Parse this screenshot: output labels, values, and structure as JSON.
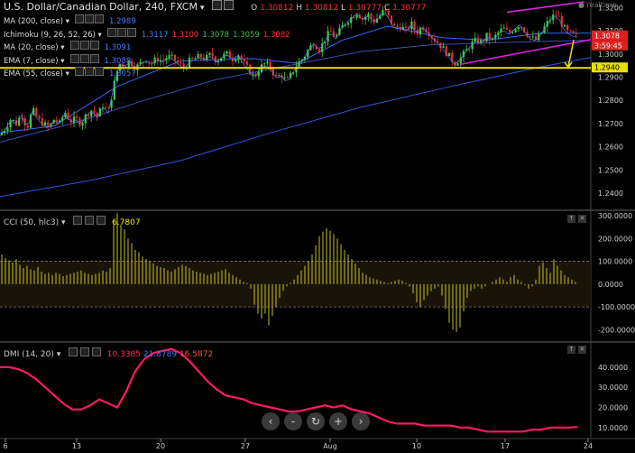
{
  "chart_data": [
    {
      "type": "candlestick",
      "title": "U.S. Dollar/Canadian Dollar, 240, FXCM",
      "ohlc_label": {
        "o": "O",
        "o_val": "1.30812",
        "h": "H",
        "h_val": "1.30812",
        "l": "L",
        "l_val": "1.30777",
        "c": "C",
        "c_val": "1.30777"
      },
      "indicators": [
        {
          "name": "MA (200, close)",
          "values": [
            "1.2989"
          ],
          "color": "#4a78ff"
        },
        {
          "name": "Ichimoku (9, 26, 52, 26)",
          "values": [
            "1.3117",
            "1.3100",
            "1.3078",
            "1.3059",
            "1.3082"
          ],
          "colors": [
            "#3f7fff",
            "#ff3030",
            "#40c040",
            "#40c040",
            "#ff3030"
          ]
        },
        {
          "name": "MA (20, close)",
          "values": [
            "1.3091"
          ],
          "color": "#4a78ff"
        },
        {
          "name": "EMA (7, close)",
          "values": [
            "1.3088"
          ],
          "color": "#4a78ff"
        },
        {
          "name": "EMA (55, close)",
          "values": [
            "1.3057"
          ],
          "color": "#4a78ff"
        }
      ],
      "ylim": [
        1.233,
        1.3225
      ],
      "y_ticks": [
        "1.3200",
        "1.3100",
        "1.3000",
        "1.2900",
        "1.2800",
        "1.2700",
        "1.2600",
        "1.2500",
        "1.2400"
      ],
      "price_badges": [
        {
          "label": "1.3078",
          "color": "#e02020",
          "value": 1.3078
        },
        {
          "label": "3:59:45",
          "color": "#e02020"
        },
        {
          "label": "1.2940",
          "color": "#e8e000",
          "value": 1.294
        }
      ],
      "support_level": 1.294,
      "price_path": [
        [
          0,
          1.265
        ],
        [
          6,
          1.268
        ],
        [
          12,
          1.272
        ],
        [
          18,
          1.27
        ],
        [
          24,
          1.274
        ],
        [
          30,
          1.268
        ],
        [
          36,
          1.276
        ],
        [
          42,
          1.272
        ],
        [
          48,
          1.27
        ],
        [
          54,
          1.268
        ],
        [
          60,
          1.272
        ],
        [
          66,
          1.27
        ],
        [
          72,
          1.275
        ],
        [
          78,
          1.271
        ],
        [
          84,
          1.272
        ],
        [
          90,
          1.27
        ],
        [
          96,
          1.274
        ],
        [
          102,
          1.276
        ],
        [
          108,
          1.273
        ],
        [
          114,
          1.278
        ],
        [
          120,
          1.275
        ],
        [
          126,
          1.286
        ],
        [
          132,
          1.296
        ],
        [
          138,
          1.295
        ],
        [
          144,
          1.297
        ],
        [
          150,
          1.294
        ],
        [
          156,
          1.296
        ],
        [
          162,
          1.298
        ],
        [
          168,
          1.296
        ],
        [
          174,
          1.298
        ],
        [
          180,
          1.297
        ],
        [
          186,
          1.299
        ],
        [
          192,
          1.298
        ],
        [
          198,
          1.296
        ],
        [
          204,
          1.294
        ],
        [
          210,
          1.297
        ],
        [
          216,
          1.298
        ],
        [
          222,
          1.299
        ],
        [
          228,
          1.298
        ],
        [
          234,
          1.3
        ],
        [
          240,
          1.297
        ],
        [
          246,
          1.299
        ],
        [
          252,
          1.3
        ],
        [
          258,
          1.298
        ],
        [
          264,
          1.3
        ],
        [
          270,
          1.296
        ],
        [
          276,
          1.293
        ],
        [
          282,
          1.29
        ],
        [
          288,
          1.294
        ],
        [
          294,
          1.296
        ],
        [
          300,
          1.294
        ],
        [
          306,
          1.29
        ],
        [
          312,
          1.291
        ],
        [
          318,
          1.288
        ],
        [
          324,
          1.292
        ],
        [
          330,
          1.296
        ],
        [
          336,
          1.298
        ],
        [
          342,
          1.302
        ],
        [
          348,
          1.305
        ],
        [
          354,
          1.302
        ],
        [
          360,
          1.306
        ],
        [
          366,
          1.31
        ],
        [
          372,
          1.307
        ],
        [
          378,
          1.311
        ],
        [
          384,
          1.314
        ],
        [
          390,
          1.316
        ],
        [
          396,
          1.318
        ],
        [
          402,
          1.315
        ],
        [
          408,
          1.317
        ],
        [
          414,
          1.314
        ],
        [
          420,
          1.316
        ],
        [
          426,
          1.319
        ],
        [
          432,
          1.315
        ],
        [
          438,
          1.311
        ],
        [
          444,
          1.312
        ],
        [
          450,
          1.31
        ],
        [
          456,
          1.313
        ],
        [
          462,
          1.309
        ],
        [
          468,
          1.312
        ],
        [
          474,
          1.31
        ],
        [
          480,
          1.307
        ],
        [
          486,
          1.305
        ],
        [
          492,
          1.302
        ],
        [
          498,
          1.299
        ],
        [
          504,
          1.296
        ],
        [
          510,
          1.298
        ],
        [
          516,
          1.301
        ],
        [
          522,
          1.304
        ],
        [
          528,
          1.306
        ],
        [
          534,
          1.305
        ],
        [
          540,
          1.308
        ],
        [
          546,
          1.306
        ],
        [
          552,
          1.309
        ],
        [
          558,
          1.311
        ],
        [
          564,
          1.309
        ],
        [
          570,
          1.311
        ],
        [
          576,
          1.313
        ],
        [
          582,
          1.31
        ],
        [
          588,
          1.307
        ],
        [
          594,
          1.306
        ],
        [
          600,
          1.309
        ],
        [
          606,
          1.313
        ],
        [
          612,
          1.316
        ],
        [
          618,
          1.317
        ],
        [
          624,
          1.312
        ],
        [
          630,
          1.309
        ],
        [
          636,
          1.308
        ],
        [
          640,
          1.3078
        ]
      ]
    },
    {
      "type": "bar",
      "title": "CCI (50, hlc3)",
      "latest_value": "6.7807",
      "ylim": [
        -250,
        320
      ],
      "y_ticks": [
        "300.0000",
        "200.0000",
        "100.0000",
        "0.0000",
        "-100.0000",
        "-200.0000"
      ],
      "bands": [
        100,
        -100
      ],
      "values": [
        130,
        115,
        105,
        95,
        110,
        85,
        70,
        80,
        65,
        60,
        75,
        55,
        45,
        50,
        40,
        50,
        45,
        35,
        40,
        45,
        50,
        55,
        60,
        50,
        45,
        40,
        45,
        50,
        60,
        55,
        70,
        280,
        310,
        260,
        240,
        200,
        180,
        150,
        140,
        120,
        110,
        100,
        90,
        80,
        75,
        70,
        60,
        55,
        65,
        75,
        85,
        80,
        70,
        60,
        55,
        50,
        45,
        40,
        45,
        50,
        55,
        60,
        65,
        50,
        40,
        30,
        20,
        10,
        5,
        -20,
        -90,
        -130,
        -150,
        -130,
        -180,
        -140,
        -100,
        -60,
        -30,
        -10,
        5,
        20,
        40,
        60,
        80,
        100,
        130,
        170,
        210,
        230,
        245,
        235,
        220,
        200,
        175,
        150,
        130,
        110,
        90,
        70,
        50,
        40,
        30,
        25,
        20,
        15,
        10,
        5,
        10,
        15,
        20,
        15,
        5,
        -10,
        -40,
        -80,
        -100,
        -70,
        -50,
        -30,
        -20,
        -10,
        -50,
        -110,
        -170,
        -200,
        -210,
        -190,
        -120,
        -60,
        -30,
        -20,
        -10,
        -20,
        -10,
        0,
        10,
        20,
        30,
        20,
        10,
        30,
        40,
        20,
        10,
        -5,
        -20,
        -10,
        20,
        80,
        95,
        70,
        50,
        110,
        80,
        60,
        40,
        30,
        20,
        10
      ]
    },
    {
      "type": "line",
      "title": "DMI (14, 20)",
      "value_labels": [
        {
          "label": "10.3385",
          "color": "#ff3060"
        },
        {
          "label": "21.8789",
          "color": "#3f7fff"
        },
        {
          "label": "16.5872",
          "color": "#ff5030"
        }
      ],
      "ylim": [
        5,
        52
      ],
      "y_ticks": [
        "40.0000",
        "30.0000",
        "20.0000",
        "10.0000"
      ],
      "x_ticks": [
        "6",
        "13",
        "20",
        "27",
        "Aug",
        "10",
        "17",
        "24"
      ],
      "series": [
        {
          "color": "#ff1a66",
          "x": [
            0,
            10,
            20,
            30,
            40,
            50,
            60,
            70,
            80,
            90,
            100,
            110,
            120,
            130,
            140,
            150,
            160,
            170,
            180,
            190,
            200,
            210,
            220,
            230,
            240,
            250,
            260,
            270,
            280,
            290,
            300,
            310,
            320,
            330,
            340,
            350,
            360,
            370,
            380,
            390,
            400,
            410,
            420,
            430,
            440,
            450,
            460,
            470,
            480,
            490,
            500,
            510,
            520,
            530,
            540,
            550,
            560,
            570,
            580,
            590,
            600,
            610,
            620,
            630,
            640
          ],
          "values": [
            40,
            40,
            39,
            37,
            34,
            30,
            26,
            22,
            19,
            19,
            21,
            24,
            22,
            20,
            28,
            38,
            44,
            47,
            48,
            49,
            47,
            43,
            38,
            33,
            29,
            26,
            25,
            24,
            22,
            21,
            20,
            19,
            18,
            18,
            19,
            20,
            21,
            20,
            21,
            19,
            18,
            17,
            15,
            13,
            12,
            12,
            12,
            11,
            11,
            11,
            11,
            10,
            10,
            9,
            8,
            8,
            8,
            8,
            8,
            9,
            9,
            10,
            10,
            10,
            10.3
          ]
        }
      ]
    }
  ],
  "watermark": "realtime",
  "toolbar": {
    "zoom_out": "-",
    "zoom_in": "+",
    "reset": "↻",
    "prev": "‹",
    "next": "›"
  }
}
